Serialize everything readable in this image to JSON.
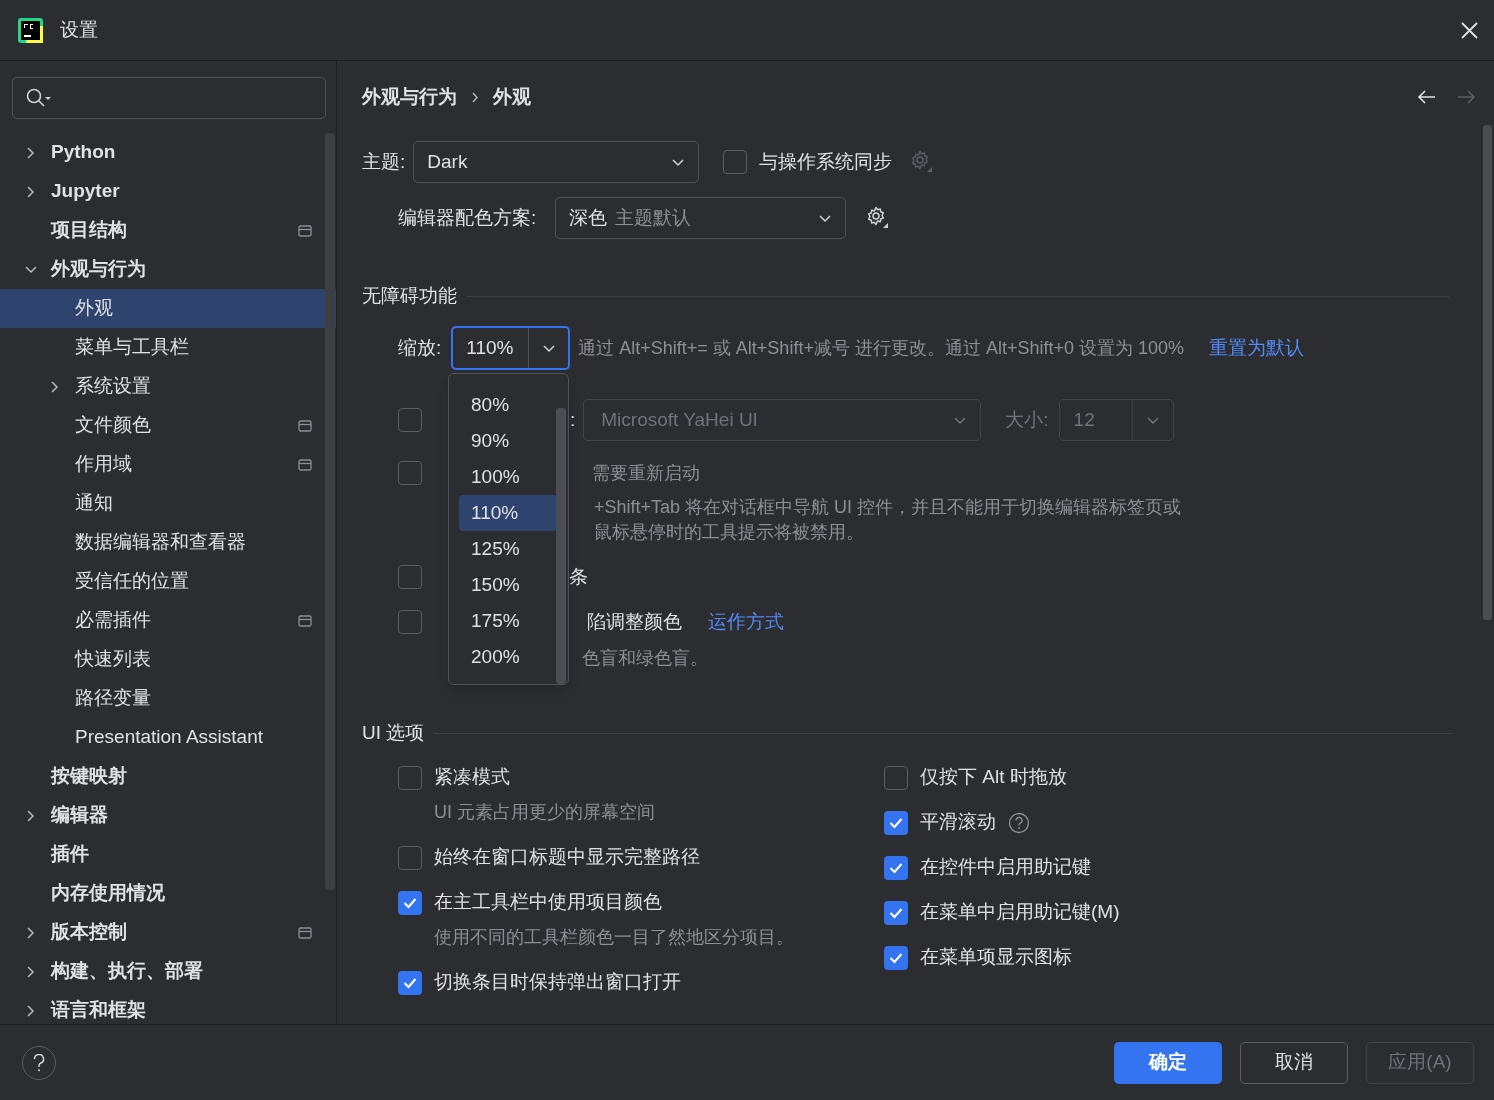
{
  "window": {
    "title": "设置"
  },
  "sidebar": {
    "items": [
      {
        "label": "Python",
        "expanded": false,
        "project_level": false
      },
      {
        "label": "Jupyter",
        "expanded": false,
        "project_level": false
      },
      {
        "label": "项目结构",
        "project_level": true
      },
      {
        "label": "外观与行为",
        "expanded": true,
        "project_level": false,
        "children": [
          {
            "label": "外观",
            "selected": true,
            "project_level": false
          },
          {
            "label": "菜单与工具栏",
            "selected": false,
            "project_level": false
          },
          {
            "label": "系统设置",
            "expanded": false,
            "selected": false,
            "project_level": false
          },
          {
            "label": "文件颜色",
            "selected": false,
            "project_level": true
          },
          {
            "label": "作用域",
            "selected": false,
            "project_level": true
          },
          {
            "label": "通知",
            "selected": false,
            "project_level": false
          },
          {
            "label": "数据编辑器和查看器",
            "selected": false,
            "project_level": false
          },
          {
            "label": "受信任的位置",
            "selected": false,
            "project_level": false
          },
          {
            "label": "必需插件",
            "selected": false,
            "project_level": true
          },
          {
            "label": "快速列表",
            "selected": false,
            "project_level": false
          },
          {
            "label": "路径变量",
            "selected": false,
            "project_level": false
          },
          {
            "label": "Presentation Assistant",
            "selected": false,
            "project_level": false
          }
        ]
      },
      {
        "label": "按键映射",
        "project_level": false
      },
      {
        "label": "编辑器",
        "expanded": false,
        "project_level": false
      },
      {
        "label": "插件",
        "project_level": false
      },
      {
        "label": "内存使用情况",
        "project_level": false
      },
      {
        "label": "版本控制",
        "expanded": false,
        "project_level": true
      },
      {
        "label": "构建、执行、部署",
        "expanded": false,
        "project_level": false
      },
      {
        "label": "语言和框架",
        "expanded": false,
        "project_level": false
      }
    ]
  },
  "breadcrumb": [
    "外观与行为",
    "外观"
  ],
  "nav": {
    "back_enabled": true,
    "forward_enabled": false
  },
  "theme": {
    "label": "主题:",
    "value": "Dark",
    "sync_label": "与操作系统同步",
    "sync_checked": false
  },
  "scheme": {
    "label": "编辑器配色方案:",
    "value": "深色",
    "hint": "主题默认"
  },
  "accessibility": {
    "title": "无障碍功能",
    "zoom_label": "缩放:",
    "zoom_value": "110%",
    "zoom_hint": "通过 Alt+Shift+= 或 Alt+Shift+减号 进行更改。通过 Alt+Shift+0 设置为 100%",
    "reset_link": "重置为默认",
    "zoom_options": [
      {
        "label": "80%",
        "selected": false
      },
      {
        "label": "90%",
        "selected": false
      },
      {
        "label": "100%",
        "selected": false
      },
      {
        "label": "110%",
        "selected": true
      },
      {
        "label": "125%",
        "selected": false
      },
      {
        "label": "150%",
        "selected": false
      },
      {
        "label": "175%",
        "selected": false
      },
      {
        "label": "200%",
        "selected": false
      }
    ],
    "rows": [
      {
        "kind": "font",
        "checked": false,
        "fragment": ":",
        "font": "Microsoft YaHei UI",
        "size_label": "大小:",
        "size": "12"
      },
      {
        "kind": "hint",
        "checked": false,
        "fragment": "需要重新启动",
        "notes": [
          "+Shift+Tab 将在对话框中导航 UI 控件，并且不能用于切换编辑器标签页或",
          "鼠标悬停时的工具提示将被禁用。"
        ]
      },
      {
        "kind": "option",
        "checked": false,
        "fragment": "条"
      },
      {
        "kind": "option",
        "checked": false,
        "fragment": "陷调整颜色",
        "link": "运作方式",
        "notes": [
          "色盲和绿色盲。"
        ]
      }
    ]
  },
  "ui_options": {
    "title": "UI 选项",
    "left": [
      {
        "label": "紧凑模式",
        "checked": false,
        "note": "UI 元素占用更少的屏幕空间"
      },
      {
        "label": "始终在窗口标题中显示完整路径",
        "checked": false
      },
      {
        "label": "在主工具栏中使用项目颜色",
        "checked": true,
        "note": "使用不同的工具栏颜色一目了然地区分项目。"
      },
      {
        "label": "切换条目时保持弹出窗口打开",
        "checked": true
      }
    ],
    "right": [
      {
        "label": "仅按下 Alt 时拖放",
        "checked": false,
        "help": false
      },
      {
        "label": "平滑滚动",
        "checked": true,
        "help": true
      },
      {
        "label": "在控件中启用助记键",
        "checked": true,
        "help": false
      },
      {
        "label": "在菜单中启用助记键(M)",
        "checked": true,
        "help": false
      },
      {
        "label": "在菜单项显示图标",
        "checked": true,
        "help": false
      }
    ]
  },
  "buttons": [
    {
      "label": "确定",
      "kind": "primary"
    },
    {
      "label": "取消",
      "kind": "normal"
    },
    {
      "label": "应用(A)",
      "kind": "disabled"
    }
  ]
}
